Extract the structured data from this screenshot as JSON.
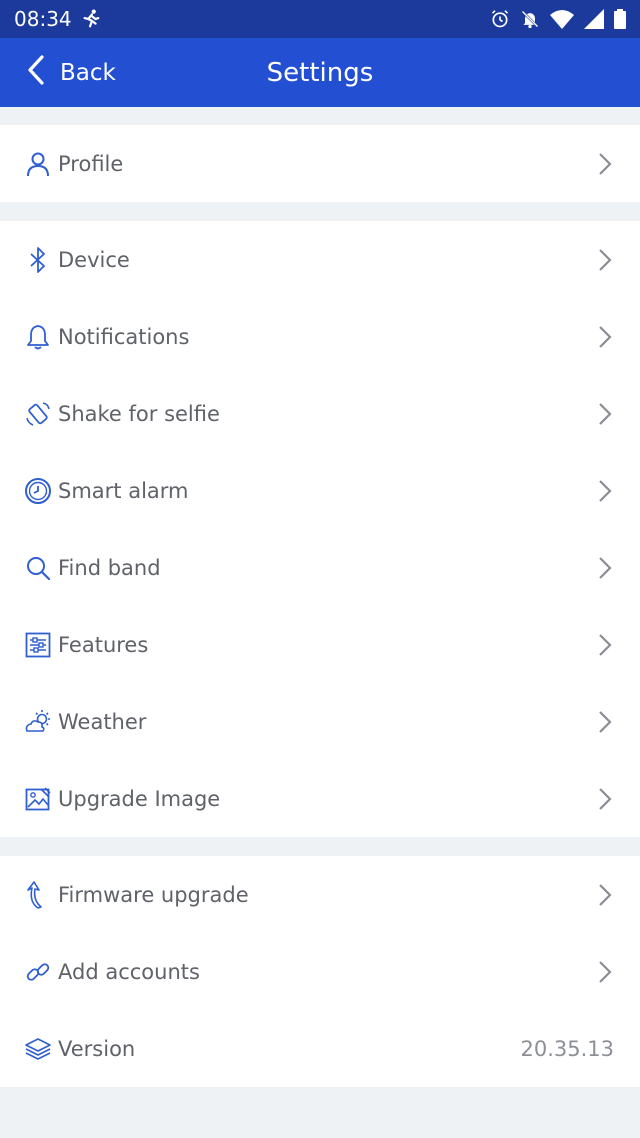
{
  "status": {
    "time": "08:34"
  },
  "header": {
    "back_label": "Back",
    "title": "Settings"
  },
  "groups": [
    {
      "items": [
        {
          "label": "Profile",
          "icon": "person-icon"
        }
      ]
    },
    {
      "items": [
        {
          "label": "Device",
          "icon": "bluetooth-icon"
        },
        {
          "label": "Notifications",
          "icon": "bell-icon"
        },
        {
          "label": "Shake for selfie",
          "icon": "shake-phone-icon"
        },
        {
          "label": "Smart alarm",
          "icon": "clock-icon"
        },
        {
          "label": "Find band",
          "icon": "search-icon"
        },
        {
          "label": "Features",
          "icon": "sliders-icon"
        },
        {
          "label": "Weather",
          "icon": "weather-icon"
        },
        {
          "label": "Upgrade Image",
          "icon": "image-icon"
        }
      ]
    },
    {
      "items": [
        {
          "label": "Firmware upgrade",
          "icon": "upgrade-arrow-icon"
        },
        {
          "label": "Add accounts",
          "icon": "link-icon"
        },
        {
          "label": "Version",
          "icon": "layers-icon",
          "value": "20.35.13"
        }
      ]
    }
  ],
  "colors": {
    "status_bar": "#1b3a9c",
    "app_bar": "#2350d3",
    "icon": "#2f5fd0",
    "chevron": "#8a8e94"
  }
}
